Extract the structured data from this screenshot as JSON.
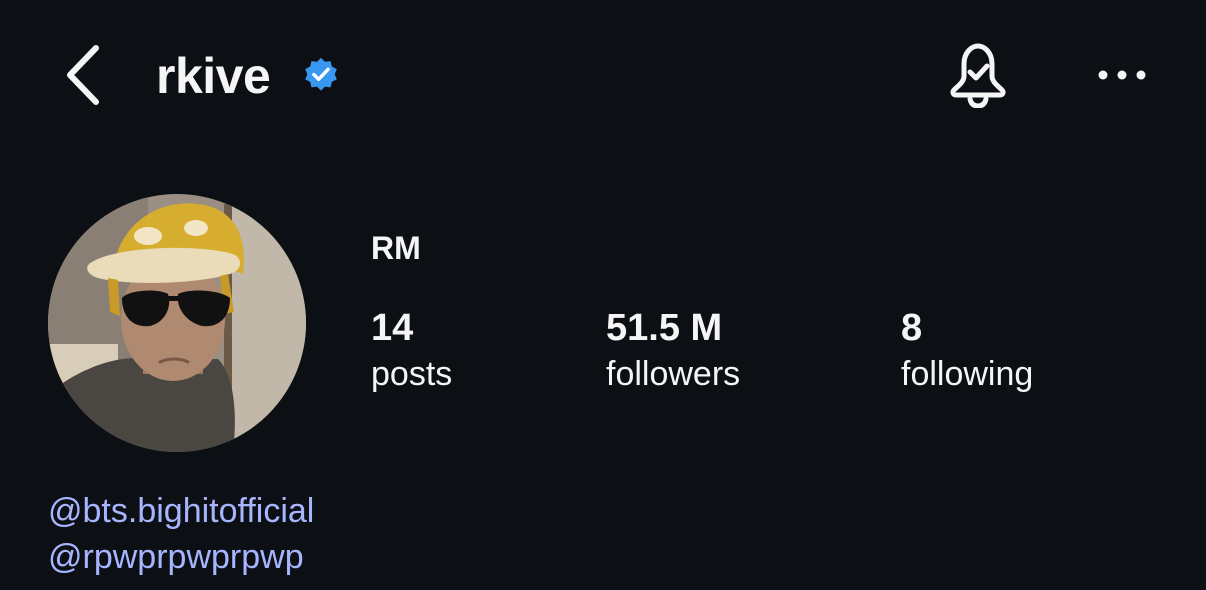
{
  "header": {
    "username": "rkive",
    "verified": true,
    "icons": {
      "back": "chevron-left-icon",
      "verified": "verified-badge-icon",
      "notifications": "bell-check-icon",
      "more": "ellipsis-icon"
    },
    "accent_color": "#3897f0"
  },
  "profile": {
    "display_name": "RM",
    "stats": [
      {
        "value": "14",
        "label": "posts"
      },
      {
        "value": "51.5 M",
        "label": "followers"
      },
      {
        "value": "8",
        "label": "following"
      }
    ],
    "bio_links": [
      "@bts.bighitofficial",
      "@rpwprpwprpwp"
    ],
    "link_color": "#a7b5ff"
  },
  "theme": {
    "background": "#0c1014",
    "text": "#f5f5f5"
  }
}
